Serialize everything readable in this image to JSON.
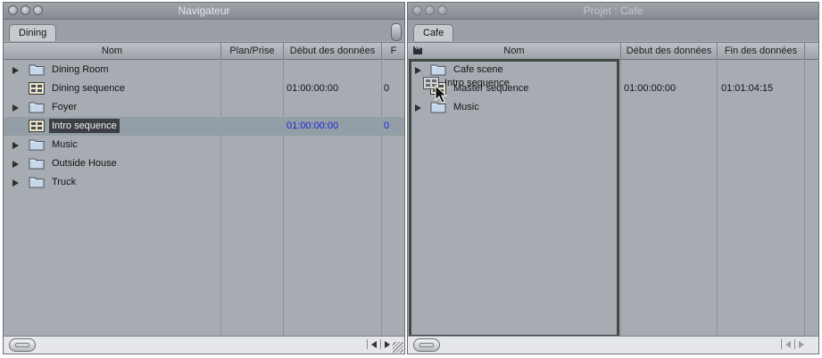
{
  "left_window": {
    "title": "Navigateur",
    "tab": "Dining",
    "columns": [
      "Nom",
      "Plan/Prise",
      "Début des données",
      "F"
    ],
    "rows": [
      {
        "label": "Dining Room",
        "type": "folder",
        "icon": "folder-icon",
        "start": "",
        "end": ""
      },
      {
        "label": "Dining sequence",
        "type": "sequence",
        "icon": "sequence-icon",
        "start": "01:00:00:00",
        "end": "0"
      },
      {
        "label": "Foyer",
        "type": "folder",
        "icon": "folder-icon",
        "start": "",
        "end": ""
      },
      {
        "label": "Intro sequence",
        "type": "sequence",
        "icon": "sequence-icon",
        "selected": true,
        "start": "01:00:00:00",
        "end": "0"
      },
      {
        "label": "Music",
        "type": "folder",
        "icon": "folder-icon",
        "start": "",
        "end": ""
      },
      {
        "label": "Outside House",
        "type": "folder",
        "icon": "folder-icon",
        "start": "",
        "end": ""
      },
      {
        "label": "Truck",
        "type": "folder",
        "icon": "folder-icon",
        "start": "",
        "end": ""
      }
    ]
  },
  "right_window": {
    "title": "Projet : Cafe",
    "tab": "Cafe",
    "columns": [
      "Nom",
      "Début des données",
      "Fin des données"
    ],
    "rows": [
      {
        "label": "Cafe scene",
        "type": "folder",
        "icon": "folder-icon",
        "start": "",
        "end": ""
      },
      {
        "label": "Master sequence",
        "type": "sequence",
        "icon": "sequence-icon",
        "start": "01:00:00:00",
        "end": "01:01:04:15"
      },
      {
        "label": "Music",
        "type": "folder",
        "icon": "folder-icon",
        "start": "",
        "end": ""
      }
    ],
    "dragged_item": {
      "label": "Intro sequence",
      "icon": "sequence-icon"
    }
  },
  "colors": {
    "selection_blue_text": "#1a28d8",
    "window_bg": "#a7abb2",
    "drop_highlight": "#3f4a45"
  }
}
